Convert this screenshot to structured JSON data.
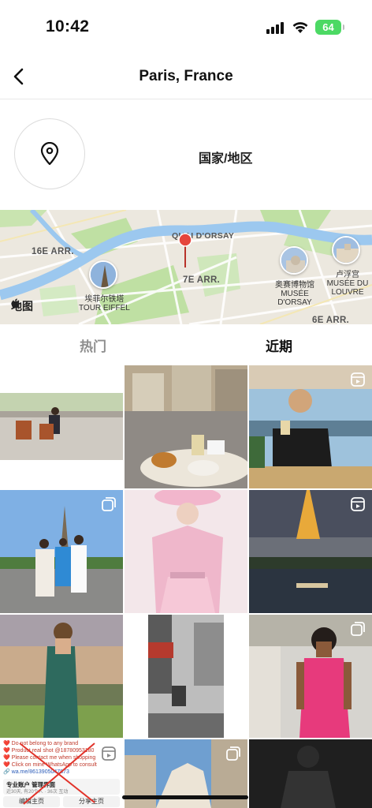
{
  "status_bar": {
    "time": "10:42",
    "battery": "64"
  },
  "header": {
    "title": "Paris, France"
  },
  "location": {
    "type_label": "国家/地区"
  },
  "map": {
    "labels": {
      "arr16": "16E ARR.",
      "arr7": "7E ARR.",
      "arr6": "6E ARR.",
      "quai": "QUAI D'ORSAY",
      "apple_maps": "地图"
    },
    "pois": [
      {
        "name": "埃菲尔铁塔",
        "subname": "TOUR EIFFEL"
      },
      {
        "name": "奥赛博物馆",
        "subname": "MUSÉE D'ORSAY"
      },
      {
        "name": "卢浮宫",
        "subname": "MUSÉE DU LOUVRE"
      }
    ]
  },
  "tabs": [
    {
      "label": "热门",
      "active": false
    },
    {
      "label": "近期",
      "active": true
    }
  ],
  "grid": {
    "ad": {
      "lines": [
        "❤️ Do not belong to any brand",
        "❤️ Product real shot @18780953180",
        "❤️ Please contact me when shopping",
        "❤️ Click on mine WhatsApp to consult",
        "🔗 wa.me/8613905047873"
      ],
      "pro_text": "专业账户 管理界面",
      "pro_sub": "近30天, 有20个人 · 36次 互动",
      "button_edit": "编辑主页",
      "button_share": "分享主页"
    }
  },
  "colors": {
    "accent_battery": "#4cd964",
    "river": "#9cc8ef",
    "park": "#bfe0a3",
    "pin": "#e5453c"
  }
}
